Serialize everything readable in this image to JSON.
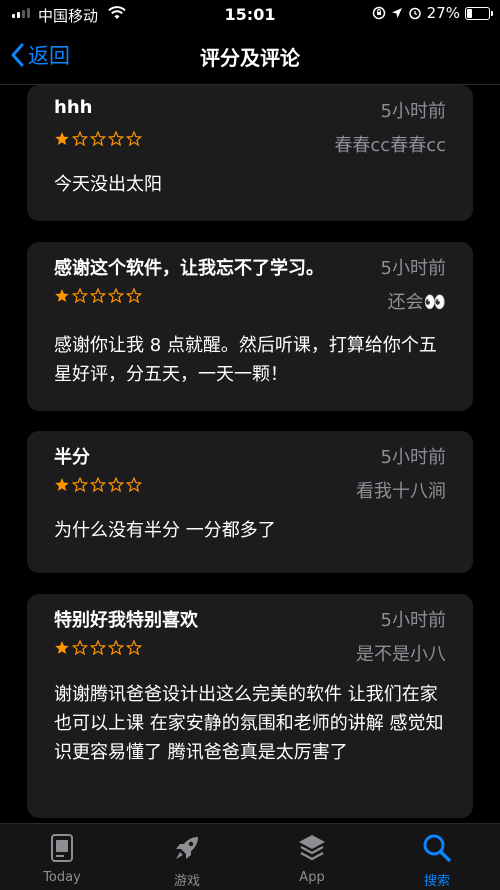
{
  "status": {
    "carrier": "中国移动",
    "time": "15:01",
    "battery": "27%",
    "battery_level": 0.27
  },
  "nav": {
    "back_label": "返回",
    "title": "评分及评论"
  },
  "reviews": [
    {
      "title": "hhh",
      "time": "5小时前",
      "author": "春春cc春春cc",
      "rating": 1,
      "body": "今天没出太阳"
    },
    {
      "title": "感谢这个软件，让我忘不了学习。",
      "time": "5小时前",
      "author": "还会👀",
      "rating": 1,
      "body": "感谢你让我 8 点就醒。然后听课，打算给你个五星好评，分五天，一天一颗！"
    },
    {
      "title": "半分",
      "time": "5小时前",
      "author": "看我十八涧",
      "rating": 1,
      "body": "为什么没有半分 一分都多了"
    },
    {
      "title": "特别好我特别喜欢",
      "time": "5小时前",
      "author": "是不是小八",
      "rating": 1,
      "body": "谢谢腾讯爸爸设计出这么完美的软件 让我们在家也可以上课 在家安静的氛围和老师的讲解 感觉知识更容易懂了 腾讯爸爸真是太厉害了"
    }
  ],
  "tabs": [
    {
      "label": "Today",
      "icon": "today-icon"
    },
    {
      "label": "游戏",
      "icon": "rocket-icon"
    },
    {
      "label": "App",
      "icon": "app-stack-icon"
    },
    {
      "label": "搜索",
      "icon": "search-icon",
      "active": true
    }
  ],
  "colors": {
    "accent": "#0a84ff",
    "star": "#ff9500",
    "card": "#1c1c1e",
    "secondary_text": "#8e8e93"
  }
}
